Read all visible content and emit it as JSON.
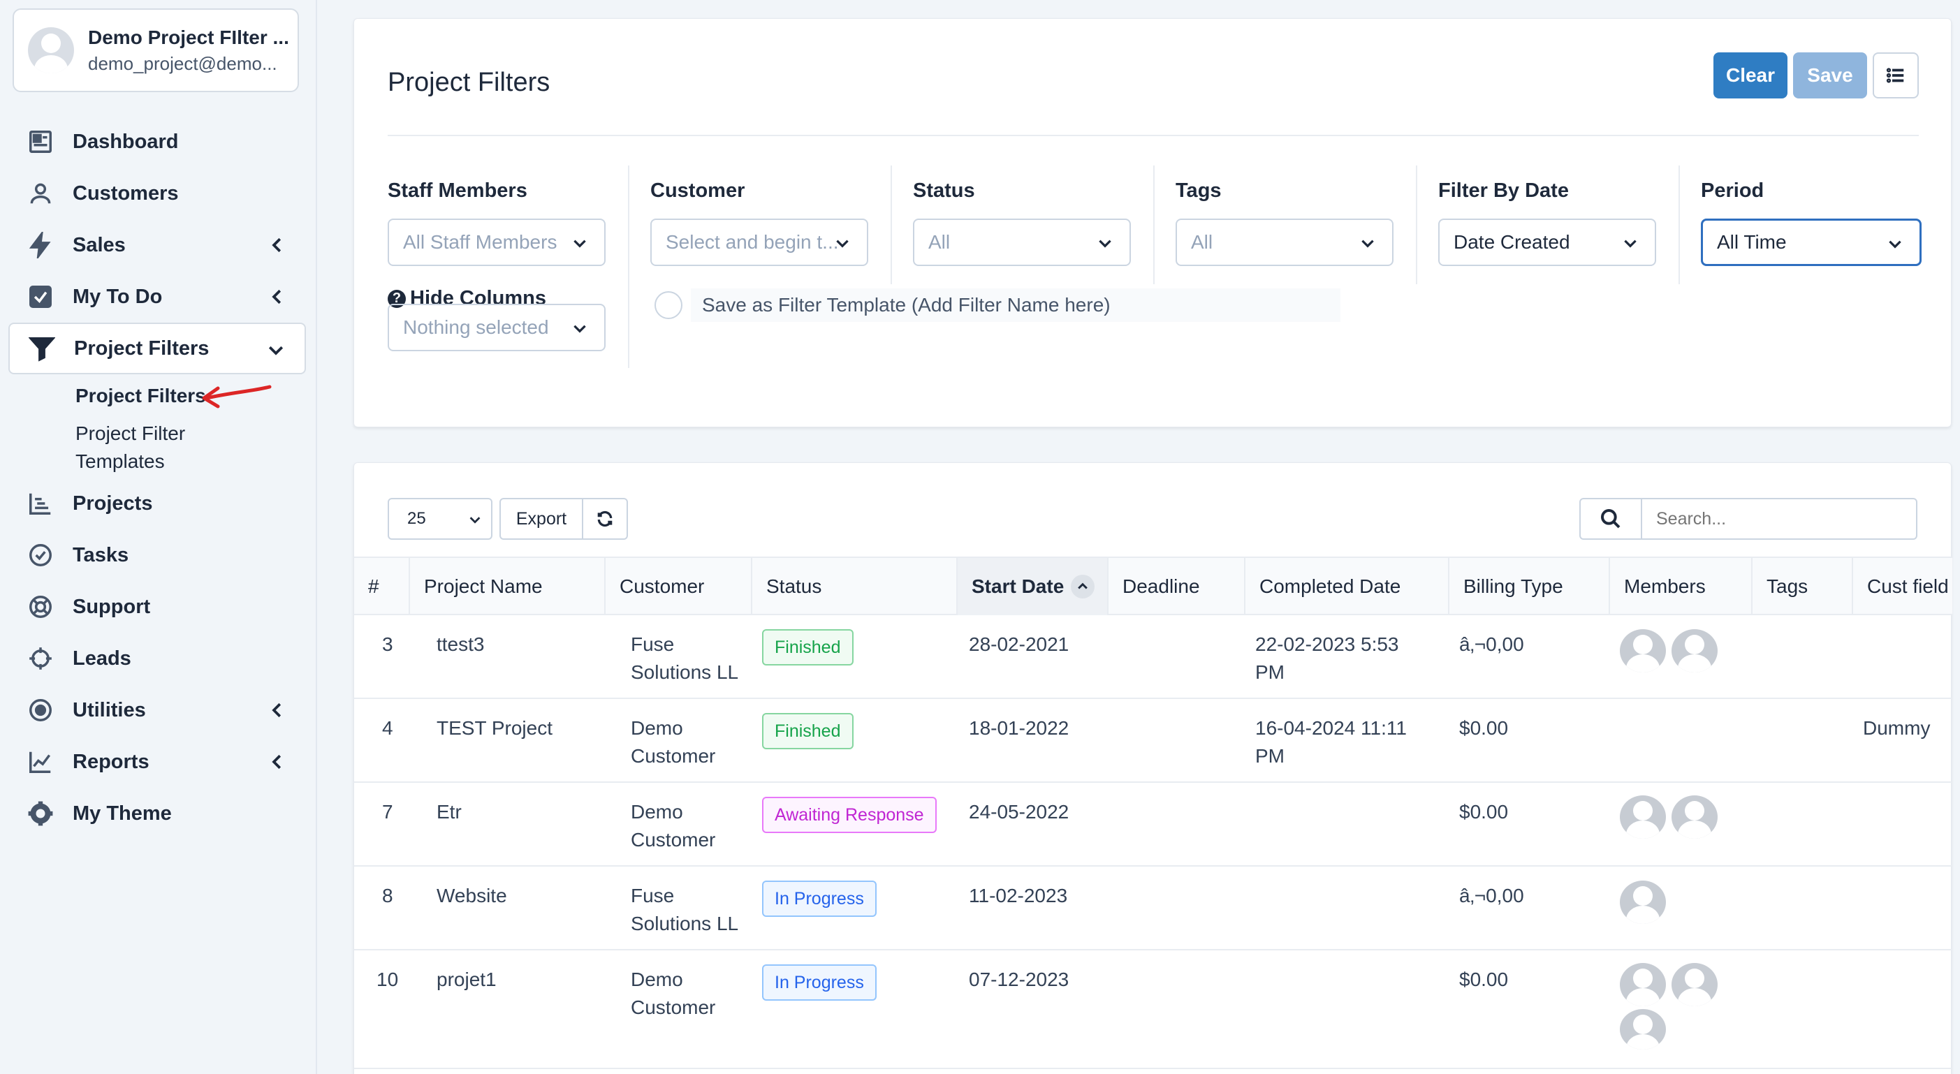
{
  "user": {
    "name": "Demo Project FIlter ...",
    "email": "demo_project@demo..."
  },
  "nav": {
    "dashboard": "Dashboard",
    "customers": "Customers",
    "sales": "Sales",
    "todo": "My To Do",
    "project_filters": "Project Filters",
    "sub_project_filters": "Project Filters",
    "sub_templates_line1": "Project Filter",
    "sub_templates_line2": "Templates",
    "projects": "Projects",
    "tasks": "Tasks",
    "support": "Support",
    "leads": "Leads",
    "utilities": "Utilities",
    "reports": "Reports",
    "theme": "My Theme"
  },
  "filters": {
    "title": "Project Filters",
    "clear_label": "Clear",
    "save_label": "Save",
    "staff_label": "Staff Members",
    "staff_value": "All Staff Members",
    "customer_label": "Customer",
    "customer_value": "Select and begin t...",
    "status_label": "Status",
    "status_value": "All",
    "tags_label": "Tags",
    "tags_value": "All",
    "date_label": "Filter By Date",
    "date_value": "Date Created",
    "period_label": "Period",
    "period_value": "All Time",
    "hide_label": "Hide Columns",
    "hide_value": "Nothing selected",
    "template_placeholder": "Save as Filter Template (Add Filter Name here)"
  },
  "table": {
    "page_length": "25",
    "export_label": "Export",
    "search_placeholder": "Search...",
    "columns": [
      "#",
      "Project Name",
      "Customer",
      "Status",
      "Start Date",
      "Deadline",
      "Completed Date",
      "Billing Type",
      "Members",
      "Tags",
      "Cust field"
    ],
    "rows": [
      {
        "id": "3",
        "name": "ttest3",
        "customer_1": "Fuse",
        "customer_2": "Solutions LL",
        "status": "Finished",
        "start": "28-02-2021",
        "deadline": "",
        "completed_1": "22-02-2023 5:53",
        "completed_2": "PM",
        "billing": "â‚¬0,00",
        "members": 2,
        "tags": "",
        "cust_field": ""
      },
      {
        "id": "4",
        "name": "TEST Project",
        "customer_1": "Demo",
        "customer_2": "Customer",
        "status": "Finished",
        "start": "18-01-2022",
        "deadline": "",
        "completed_1": "16-04-2024 11:11",
        "completed_2": "PM",
        "billing": "$0.00",
        "members": 0,
        "tags": "",
        "cust_field": "Dummy"
      },
      {
        "id": "7",
        "name": "Etr",
        "customer_1": "Demo",
        "customer_2": "Customer",
        "status": "Awaiting Response",
        "start": "24-05-2022",
        "deadline": "",
        "completed_1": "",
        "completed_2": "",
        "billing": "$0.00",
        "members": 2,
        "tags": "",
        "cust_field": ""
      },
      {
        "id": "8",
        "name": "Website",
        "customer_1": "Fuse",
        "customer_2": "Solutions LL",
        "status": "In Progress",
        "start": "11-02-2023",
        "deadline": "",
        "completed_1": "",
        "completed_2": "",
        "billing": "â‚¬0,00",
        "members": 1,
        "tags": "",
        "cust_field": ""
      },
      {
        "id": "10",
        "name": "projet1",
        "customer_1": "Demo",
        "customer_2": "Customer",
        "status": "In Progress",
        "start": "07-12-2023",
        "deadline": "",
        "completed_1": "",
        "completed_2": "",
        "billing": "$0.00",
        "members": 3,
        "tags": "",
        "cust_field": ""
      }
    ]
  },
  "colors": {
    "primary": "#2f7dc3",
    "primary_light": "#8fb5dd",
    "finished": "#16a34a",
    "awaiting": "#c026d3",
    "progress": "#2563eb",
    "annotation_arrow": "#dc2626"
  }
}
